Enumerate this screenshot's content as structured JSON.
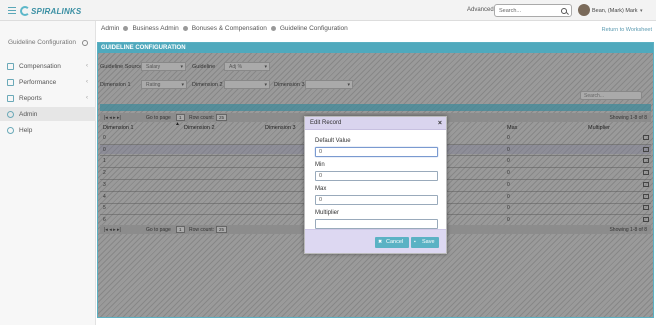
{
  "header": {
    "app_name": "SPIRALINKS",
    "advanced_label": "Advanced",
    "search_placeholder": "Search...",
    "user_name": "Bean, (Mark) Mark"
  },
  "breadcrumb": [
    "Admin",
    "Business Admin",
    "Bonuses & Compensation",
    "Guideline Configuration"
  ],
  "return_link": "Return to Worksheet",
  "sidebar": {
    "title": "Guideline Configuration",
    "items": [
      {
        "label": "Compensation",
        "icon": "compensation-icon",
        "chevron": "‹"
      },
      {
        "label": "Performance",
        "icon": "performance-icon",
        "chevron": "‹"
      },
      {
        "label": "Reports",
        "icon": "reports-icon",
        "chevron": "‹"
      },
      {
        "label": "Admin",
        "icon": "gear-icon",
        "chevron": ""
      },
      {
        "label": "Help",
        "icon": "help-icon",
        "chevron": ""
      }
    ]
  },
  "panel": {
    "title": "GUIDELINE CONFIGURATION",
    "guideline_source_label": "Guideline Source",
    "guideline_source_value": "Salary",
    "guideline_label": "Guideline",
    "guideline_value": "Adj %",
    "dimension1_label": "Dimension 1",
    "dimension1_value": "Rating",
    "dimension2_label": "Dimension 2",
    "dimension3_label": "Dimension 3",
    "grid_search_placeholder": "Search...",
    "pager": {
      "go_to_page": "Go to page",
      "page": "1",
      "row_count_label": "Row count:",
      "row_count": "25",
      "showing": "Showing 1-8 of 8"
    },
    "columns": [
      "Dimension 1",
      "Dimension 2",
      "Dimension 3",
      "Max",
      "Multiplier"
    ],
    "rows": [
      {
        "dim1": "0",
        "max": "0"
      },
      {
        "dim1": "0",
        "max": "0"
      },
      {
        "dim1": "1",
        "max": "0"
      },
      {
        "dim1": "2",
        "max": "0"
      },
      {
        "dim1": "3",
        "max": "0"
      },
      {
        "dim1": "4",
        "max": "0"
      },
      {
        "dim1": "5",
        "max": "0"
      },
      {
        "dim1": "6",
        "max": "0"
      }
    ]
  },
  "modal": {
    "title": "Edit Record",
    "close": "×",
    "fields": [
      {
        "label": "Default Value",
        "value": "0"
      },
      {
        "label": "Min",
        "value": "0"
      },
      {
        "label": "Max",
        "value": "0"
      },
      {
        "label": "Multiplier",
        "value": ""
      }
    ],
    "cancel_label": "Cancel",
    "save_label": "Save"
  }
}
